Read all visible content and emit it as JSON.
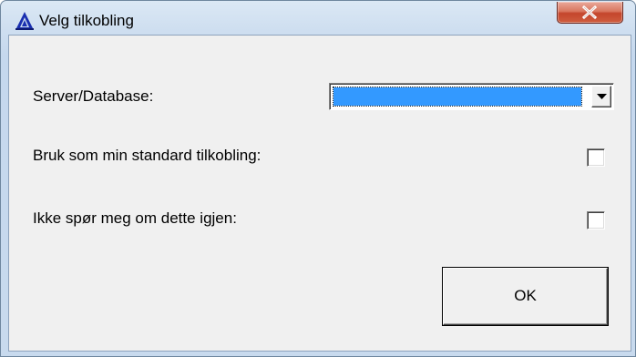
{
  "window": {
    "title": "Velg tilkobling",
    "app_icon": "triangle-a-logo-icon",
    "close_icon": "close-icon"
  },
  "form": {
    "server_label": "Server/Database:",
    "server_value": "",
    "dropdown_icon": "chevron-down-icon",
    "default_connection_label": "Bruk som min standard tilkobling:",
    "default_connection_checked": false,
    "dont_ask_label": "Ikke spør meg om dette igjen:",
    "dont_ask_checked": false,
    "ok_label": "OK"
  },
  "colors": {
    "selection_highlight": "#3399ff",
    "close_button": "#c4462c",
    "client_background": "#f0f0f0"
  }
}
